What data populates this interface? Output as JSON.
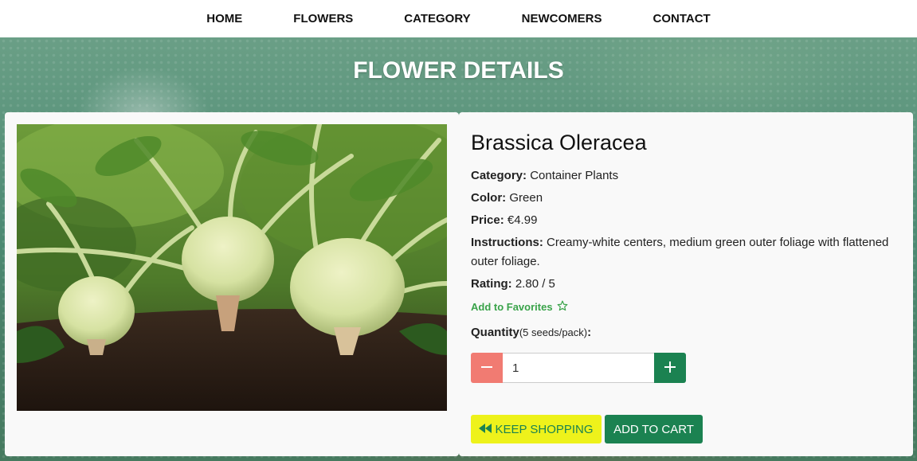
{
  "nav": {
    "items": [
      "HOME",
      "FLOWERS",
      "CATEGORY",
      "NEWCOMERS",
      "CONTACT"
    ]
  },
  "page_title": "FLOWER DETAILS",
  "product": {
    "image_alt": "kohlrabi plants growing in soil",
    "name": "Brassica Oleracea",
    "category_label": "Category:",
    "category": "Container Plants",
    "color_label": "Color:",
    "color": "Green",
    "price_label": "Price:",
    "price": "€4.99",
    "instructions_label": "Instructions:",
    "instructions": "Creamy-white centers, medium green outer foliage with flattened outer foliage.",
    "rating_label": "Rating:",
    "rating": "2.80 / 5",
    "favorites_label": "Add to Favorites"
  },
  "quantity": {
    "label": "Quantity",
    "note": "(5 seeds/pack)",
    "colon": ":",
    "value": "1",
    "minus_icon": "minus-icon",
    "plus_icon": "plus-icon"
  },
  "buttons": {
    "keep_shopping": "KEEP SHOPPING",
    "add_to_cart": "ADD TO CART"
  },
  "colors": {
    "accent_green": "#1b8251",
    "favorites_green": "#3aa34a",
    "minus_red": "#f17b72",
    "keep_yellow": "#eef21b"
  }
}
